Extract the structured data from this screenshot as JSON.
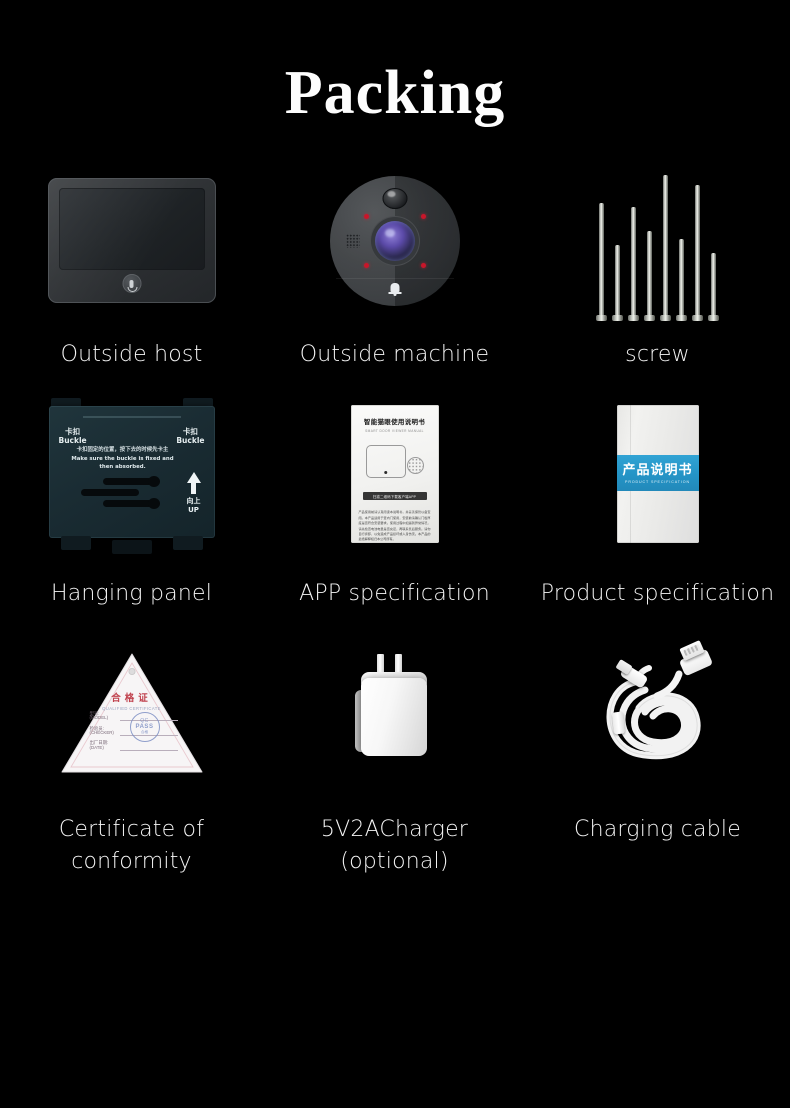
{
  "page": {
    "title": "Packing",
    "background_color": "#000000",
    "text_color": "#f4f4f4",
    "accent_blue": "#2494c6",
    "accent_red": "#c0414d"
  },
  "items": [
    {
      "id": "outside-host",
      "label": "Outside host",
      "icon": "indoor-monitor-icon"
    },
    {
      "id": "outside-machine",
      "label": "Outside machine",
      "icon": "doorbell-camera-icon"
    },
    {
      "id": "screw",
      "label": "screw",
      "icon": "screws-icon",
      "screw_count": 8,
      "screw_heights": [
        112,
        70,
        108,
        84,
        140,
        76,
        130,
        62
      ]
    },
    {
      "id": "hanging-panel",
      "label": "Hanging panel",
      "icon": "mounting-bracket-icon",
      "panel": {
        "buckle_cn": "卡扣",
        "buckle_en": "Buckle",
        "note_cn": "卡扣固定的位置，按下去的时候先卡主",
        "note_en": "Make sure the buckle is fixed and then absorbed.",
        "up_cn": "向上",
        "up_en": "UP"
      }
    },
    {
      "id": "app-specification",
      "label": "APP specification",
      "icon": "app-manual-icon",
      "booklet": {
        "title_cn": "智能猫眼使用说明书",
        "subtitle_en": "SMART DOOR VIEWER MANUAL",
        "bar_text": "扫描二维码下载客户端APP",
        "body_text": "产品使用前请认真阅读本说明书，并妥善保管以备查阅。本产品适用于室内门使用，安装前请确认门板厚度是否符合安装要求。使用过程中如遇到异常情况，请先检查电池电量是否充足，再联系售后服务。请勿自行拆卸，以免造成产品损坏或人身伤害。本产品的最终解释权归本公司所有。"
      }
    },
    {
      "id": "product-specification",
      "label": "Product specification",
      "icon": "product-manual-icon",
      "booklet": {
        "title_cn": "产品说明书",
        "title_en": "PRODUCT SPECIFICATION",
        "band_color": "#2494c6"
      }
    },
    {
      "id": "certificate-of-conformity",
      "label": "Certificate of\nconformity",
      "icon": "certificate-triangle-icon",
      "certificate": {
        "title_cn": "合格证",
        "title_en": "QUALIFIED CERTIFICATE",
        "fields": [
          {
            "cn": "型号:",
            "en": "(MODEL)"
          },
          {
            "cn": "检验员:",
            "en": "(CHECKER)"
          },
          {
            "cn": "出厂日期:",
            "en": "(DATE)"
          }
        ],
        "stamp_line1": "QC",
        "stamp_line2": "PASS",
        "stamp_line3": "合格"
      }
    },
    {
      "id": "charger",
      "label": "5V2ACharger\n(optional)",
      "icon": "power-adapter-icon"
    },
    {
      "id": "charging-cable",
      "label": "Charging cable",
      "icon": "usb-cable-icon"
    }
  ]
}
